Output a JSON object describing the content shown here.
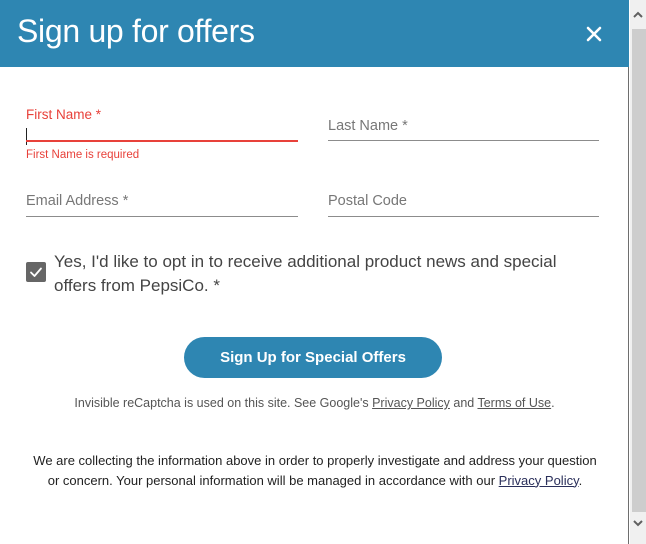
{
  "header": {
    "title": "Sign up for offers",
    "close_icon": "close-icon"
  },
  "form": {
    "first_name": {
      "label": "First Name *",
      "value": "",
      "error": "First Name is required",
      "state": "error"
    },
    "last_name": {
      "label": "Last Name *",
      "value": ""
    },
    "email": {
      "label": "Email Address *",
      "value": ""
    },
    "postal_code": {
      "label": "Postal Code",
      "value": ""
    },
    "optin": {
      "checked": true,
      "label": "Yes, I'd like to opt in to receive additional product news and special offers from PepsiCo. *"
    },
    "submit_label": "Sign Up for Special Offers"
  },
  "recaptcha": {
    "text_before": "Invisible reCaptcha is used on this site. See Google's ",
    "privacy_link": "Privacy Policy",
    "text_middle": " and ",
    "terms_link": "Terms of Use",
    "text_after": "."
  },
  "disclaimer": {
    "text": "We are collecting the information above in order to properly investigate and address your question or concern. Your personal information will be managed in accordance with our ",
    "privacy_link": "Privacy Policy",
    "text_after": "."
  },
  "colors": {
    "brand": "#2e86b2",
    "error": "#e8413a",
    "checkbox": "#666666"
  }
}
